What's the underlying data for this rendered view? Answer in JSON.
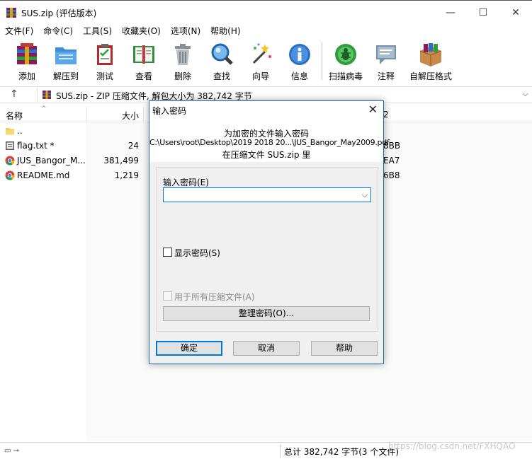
{
  "window": {
    "title": "SUS.zip (评估版本)",
    "min_glyph": "—",
    "max_glyph": "☐",
    "close_glyph": "✕"
  },
  "menu": [
    "文件(F)",
    "命令(C)",
    "工具(S)",
    "收藏夹(O)",
    "选项(N)",
    "帮助(H)"
  ],
  "toolbar": [
    {
      "label": "添加",
      "icon": "add-archive-icon"
    },
    {
      "label": "解压到",
      "icon": "extract-folder-icon"
    },
    {
      "label": "测试",
      "icon": "test-clipboard-icon"
    },
    {
      "label": "查看",
      "icon": "view-book-icon"
    },
    {
      "label": "删除",
      "icon": "trash-icon"
    },
    {
      "label": "查找",
      "icon": "magnifier-icon"
    },
    {
      "label": "向导",
      "icon": "wizard-wand-icon"
    },
    {
      "label": "信息",
      "icon": "info-icon"
    },
    {
      "label": "扫描病毒",
      "icon": "virus-scan-icon"
    },
    {
      "label": "注释",
      "icon": "comment-icon"
    },
    {
      "label": "自解压格式",
      "icon": "sfx-box-icon"
    }
  ],
  "address": {
    "up_glyph": "↑",
    "text": "SUS.zip - ZIP 压缩文件, 解包大小为 382,742 字节",
    "drop_glyph": "⌵"
  },
  "list": {
    "columns": {
      "name": "名称",
      "size": "大小",
      "crc_fragment": "2"
    },
    "sort_glyph": "^",
    "rows": [
      {
        "name": "..",
        "size": "",
        "crc": "",
        "icon": "folder-icon"
      },
      {
        "name": "flag.txt *",
        "size": "24",
        "crc": "8BB",
        "icon": "text-file-icon"
      },
      {
        "name": "JUS_Bangor_M...",
        "size": "381,499",
        "crc": "EA7",
        "icon": "chrome-icon"
      },
      {
        "name": "README.md",
        "size": "1,219",
        "crc": "6B8",
        "icon": "chrome-icon"
      }
    ]
  },
  "status": {
    "icons_glyph": "▭ ⊸",
    "text": "总计 382,742 字节(3 个文件)",
    "watermark": "https://blog.csdn.net/FXHQAO"
  },
  "dialog": {
    "title": "输入密码",
    "close_glyph": "✕",
    "header_line1": "为加密的文件输入密码",
    "header_line2": "C:\\Users\\root\\Desktop\\2019 2018 20...\\JUS_Bangor_May2009.pdf",
    "header_line3": "在压缩文件 SUS.zip 里",
    "password_label": "输入密码(E)",
    "password_value": "",
    "password_drop": "⌵",
    "show_password": "显示密码(S)",
    "use_for_all": "用于所有压缩文件(A)",
    "organize_button": "整理密码(O)...",
    "ok": "确定",
    "cancel": "取消",
    "help": "帮助"
  },
  "colors": {
    "accent": "#0078d7",
    "dialog_border": "#1c6ea4"
  }
}
